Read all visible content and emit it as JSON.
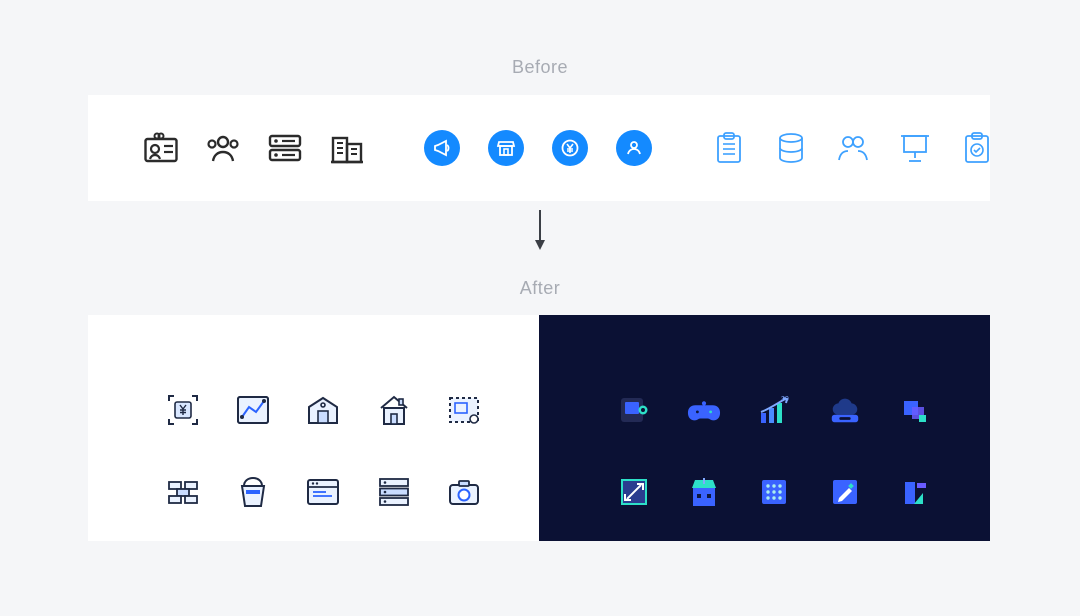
{
  "labels": {
    "before": "Before",
    "after": "After"
  },
  "colors": {
    "pageBg": "#f5f6f8",
    "panelBg": "#ffffff",
    "darkPanelBg": "#0b1134",
    "strokeDark": "#2b2b2b",
    "brandBlue": "#148aff",
    "outlineBlue": "#3ea1ff",
    "accentCyan": "#44e0d3",
    "accentPurple": "#6a5bff"
  },
  "before": {
    "group1": [
      "id-card-icon",
      "group-icon",
      "list-lines-icon",
      "buildings-icon"
    ],
    "group2": [
      "megaphone-icon",
      "store-icon",
      "yen-icon",
      "org-icon"
    ],
    "group3": [
      "clipboard-list-icon",
      "database-icon",
      "people-icon",
      "presentation-icon",
      "clipboard-check-icon"
    ]
  },
  "after": {
    "lightGrid": [
      "yen-frame-icon",
      "chart-line-icon",
      "warehouse-icon",
      "house-icon",
      "blueprint-icon",
      "bricks-icon",
      "bucket-icon",
      "browser-window-icon",
      "rows-icon",
      "camera-icon"
    ],
    "darkGrid": [
      "device-icon",
      "gamepad-icon",
      "growth-chart-icon",
      "cloud-storage-icon",
      "block-stack-icon",
      "expand-icon",
      "store-dark-icon",
      "grid-icon",
      "edit-icon",
      "shapes-icon"
    ]
  }
}
